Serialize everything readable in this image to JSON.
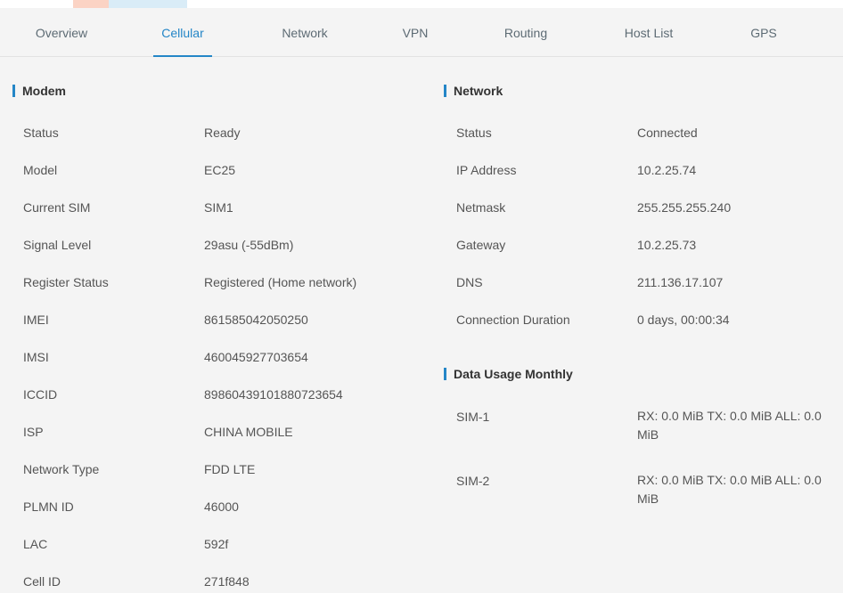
{
  "tabs": [
    {
      "label": "Overview"
    },
    {
      "label": "Cellular"
    },
    {
      "label": "Network"
    },
    {
      "label": "VPN"
    },
    {
      "label": "Routing"
    },
    {
      "label": "Host List"
    },
    {
      "label": "GPS"
    }
  ],
  "active_tab": "Cellular",
  "modem": {
    "title": "Modem",
    "rows": [
      {
        "label": "Status",
        "value": "Ready"
      },
      {
        "label": "Model",
        "value": "EC25"
      },
      {
        "label": "Current SIM",
        "value": "SIM1"
      },
      {
        "label": "Signal Level",
        "value": "29asu (-55dBm)"
      },
      {
        "label": "Register Status",
        "value": "Registered (Home network)"
      },
      {
        "label": "IMEI",
        "value": "861585042050250"
      },
      {
        "label": "IMSI",
        "value": "460045927703654"
      },
      {
        "label": "ICCID",
        "value": "89860439101880723654"
      },
      {
        "label": "ISP",
        "value": "CHINA MOBILE"
      },
      {
        "label": "Network Type",
        "value": "FDD LTE"
      },
      {
        "label": "PLMN ID",
        "value": "46000"
      },
      {
        "label": "LAC",
        "value": "592f"
      },
      {
        "label": "Cell ID",
        "value": "271f848"
      }
    ]
  },
  "network": {
    "title": "Network",
    "rows": [
      {
        "label": "Status",
        "value": "Connected"
      },
      {
        "label": "IP Address",
        "value": "10.2.25.74"
      },
      {
        "label": "Netmask",
        "value": "255.255.255.240"
      },
      {
        "label": "Gateway",
        "value": "10.2.25.73"
      },
      {
        "label": "DNS",
        "value": "211.136.17.107"
      },
      {
        "label": "Connection Duration",
        "value": "0 days, 00:00:34"
      }
    ]
  },
  "data_usage": {
    "title": "Data Usage Monthly",
    "rows": [
      {
        "label": "SIM-1",
        "value": "RX: 0.0 MiB TX: 0.0 MiB ALL: 0.0 MiB"
      },
      {
        "label": "SIM-2",
        "value": "RX: 0.0 MiB TX: 0.0 MiB ALL: 0.0 MiB"
      }
    ]
  },
  "colors": {
    "accent": "#2486c7",
    "panel_bg": "#f4f4f4",
    "text": "#555555"
  }
}
